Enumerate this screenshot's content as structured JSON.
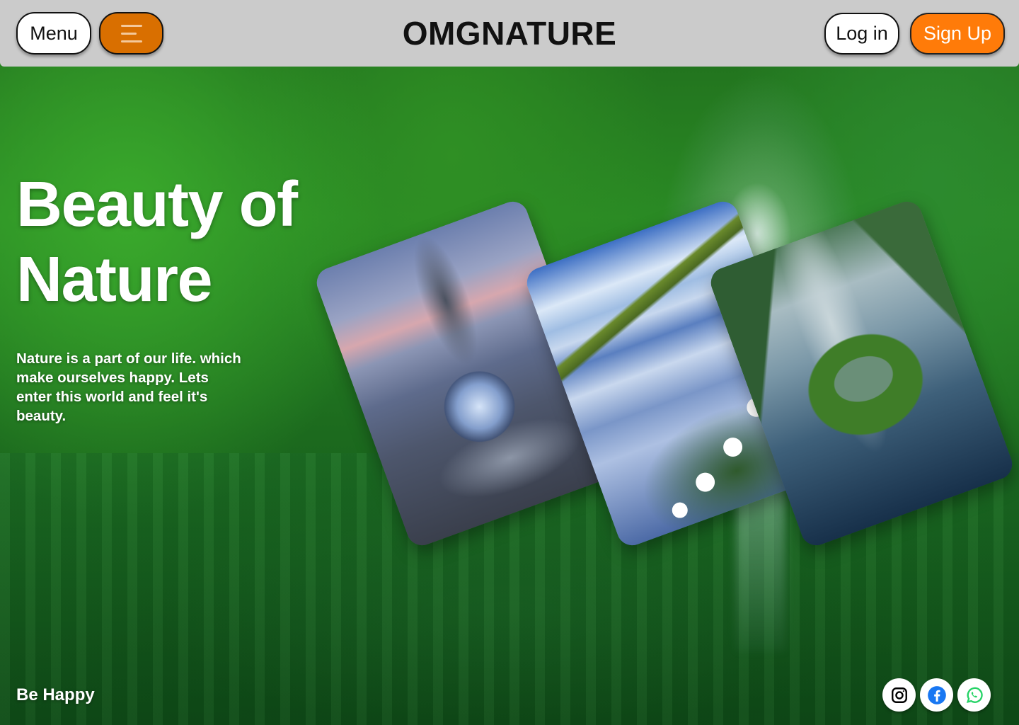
{
  "header": {
    "menu_label": "Menu",
    "brand": "OMGNATURE",
    "login_label": "Log in",
    "signup_label": "Sign Up",
    "hamburger_icon": "hamburger-icon"
  },
  "hero": {
    "title_line1": "Beauty of",
    "title_line2": "Nature",
    "description": "Nature is a part of our life. which make ourselves happy. Lets enter this world and feel it's beauty."
  },
  "gallery": {
    "cards": [
      {
        "name": "crystal-ball-card"
      },
      {
        "name": "lake-flowers-card"
      },
      {
        "name": "heart-island-card"
      }
    ]
  },
  "footer": {
    "tagline": "Be Happy",
    "social": [
      {
        "icon": "instagram-icon",
        "color": "#000000"
      },
      {
        "icon": "facebook-icon",
        "color": "#1877F2"
      },
      {
        "icon": "whatsapp-icon",
        "color": "#25D366"
      }
    ]
  },
  "colors": {
    "header_bg": "#cbcbcb",
    "accent_orange": "#ff7b09",
    "menu_toggle_orange": "#d96f00"
  }
}
